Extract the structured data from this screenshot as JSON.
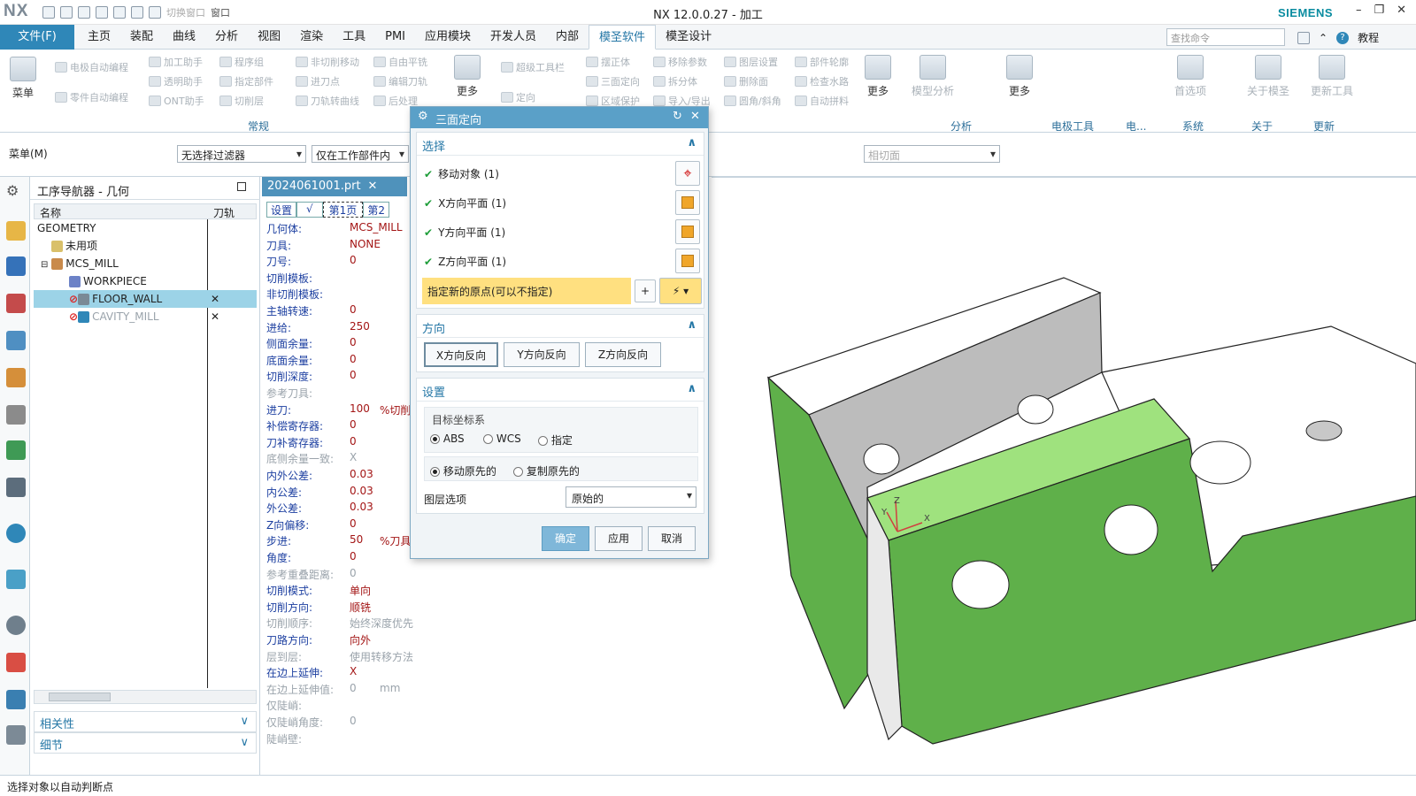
{
  "titlebar": {
    "logo": "NX",
    "quick_access": [
      "切换窗口",
      "窗口"
    ],
    "title": "NX 12.0.0.27 - 加工",
    "brand": "SIEMENS",
    "controls": [
      "–",
      "❐",
      "✕"
    ]
  },
  "menubar": {
    "file": "文件(F)",
    "tabs": [
      "主页",
      "装配",
      "曲线",
      "分析",
      "视图",
      "渲染",
      "工具",
      "PMI",
      "应用模块",
      "开发人员",
      "内部",
      "模圣软件",
      "模圣设计"
    ],
    "active_tab": "模圣软件",
    "search_placeholder": "查找命令",
    "tutorial": "教程"
  },
  "ribbon": {
    "menu_label": "菜单",
    "more_label": "更多",
    "col1": [
      "电极自动编程",
      "零件自动编程"
    ],
    "col2": [
      "加工助手",
      "透明助手",
      "ONT助手"
    ],
    "col3": [
      "程序组",
      "指定部件",
      "切削层"
    ],
    "col4": [
      "非切削移动",
      "进刀点",
      "刀轨转曲线"
    ],
    "col5": [
      "自由平铣",
      "编辑刀轨",
      "后处理"
    ],
    "col6": [
      "超级工具栏",
      "定向"
    ],
    "col7": [
      "摆正体",
      "三面定向",
      "区域保护"
    ],
    "col8": [
      "移除参数",
      "拆分体",
      "导入/导出"
    ],
    "col9": [
      "图层设置",
      "删除面",
      "圆角/斜角"
    ],
    "col10": [
      "部件轮廓",
      "检查水路",
      "自动拼料"
    ],
    "group_general": "常规",
    "model_analysis": "模型分析",
    "first_choice": "首选项",
    "about": "关于模圣",
    "update_tool": "更新工具",
    "groups_right": [
      "分析",
      "电极工具",
      "电...",
      "系统",
      "关于",
      "更新"
    ]
  },
  "toolbar2": {
    "menu_m": "菜单(M)",
    "filter": "无选择过滤器",
    "scope": "仅在工作部件内",
    "snap": "相切面"
  },
  "nav": {
    "title": "工序导航器 - 几何",
    "col_name": "名称",
    "col_path": "刀轨",
    "rows": [
      {
        "label": "GEOMETRY",
        "mark": ""
      },
      {
        "label": "未用项",
        "mark": ""
      },
      {
        "label": "MCS_MILL",
        "mark": ""
      },
      {
        "label": "WORKPIECE",
        "mark": ""
      },
      {
        "label": "FLOOR_WALL",
        "mark": "✕"
      },
      {
        "label": "CAVITY_MILL",
        "mark": "✕"
      }
    ],
    "acc_related": "相关性",
    "acc_detail": "细节"
  },
  "file_tab": "2024061001.prt",
  "props": {
    "tabs": [
      "设置",
      "√",
      "第1页",
      "第2"
    ],
    "rows": [
      {
        "k": "几何体:",
        "v": "MCS_MILL",
        "u": ""
      },
      {
        "k": "刀具:",
        "v": "NONE",
        "u": ""
      },
      {
        "k": "刀号:",
        "v": "0",
        "u": ""
      },
      {
        "k": "切削模板:",
        "v": "",
        "u": ""
      },
      {
        "k": "非切削模板:",
        "v": "",
        "u": ""
      },
      {
        "k": "主轴转速:",
        "v": "0",
        "u": ""
      },
      {
        "k": "进给:",
        "v": "250",
        "u": ""
      },
      {
        "k": "侧面余量:",
        "v": "0",
        "u": ""
      },
      {
        "k": "底面余量:",
        "v": "0",
        "u": ""
      },
      {
        "k": "切削深度:",
        "v": "0",
        "u": ""
      },
      {
        "k": "参考刀具:",
        "v": "",
        "u": "",
        "grey": true
      },
      {
        "k": "进刀:",
        "v": "100",
        "u": "%切削"
      },
      {
        "k": "补偿寄存器:",
        "v": "0",
        "u": ""
      },
      {
        "k": "刀补寄存器:",
        "v": "0",
        "u": ""
      },
      {
        "k": "底侧余量一致:",
        "v": "X",
        "u": "",
        "grey": true
      },
      {
        "k": "内外公差:",
        "v": "0.03",
        "u": ""
      },
      {
        "k": "内公差:",
        "v": "0.03",
        "u": ""
      },
      {
        "k": "外公差:",
        "v": "0.03",
        "u": ""
      },
      {
        "k": "Z向偏移:",
        "v": "0",
        "u": ""
      },
      {
        "k": "步进:",
        "v": "50",
        "u": "%刀具"
      },
      {
        "k": "角度:",
        "v": "0",
        "u": ""
      },
      {
        "k": "参考重叠距离:",
        "v": "0",
        "u": "",
        "grey": true
      },
      {
        "k": "切削模式:",
        "v": "单向",
        "u": ""
      },
      {
        "k": "切削方向:",
        "v": "顺铣",
        "u": ""
      },
      {
        "k": "切削顺序:",
        "v": "始终深度优先",
        "u": "",
        "grey": true
      },
      {
        "k": "刀路方向:",
        "v": "向外",
        "u": ""
      },
      {
        "k": "层到层:",
        "v": "使用转移方法",
        "u": "",
        "grey": true
      },
      {
        "k": "在边上延伸:",
        "v": "X",
        "u": ""
      },
      {
        "k": "在边上延伸值:",
        "v": "0",
        "u": "mm",
        "grey": true
      },
      {
        "k": "仅陡峭:",
        "v": "",
        "u": "",
        "grey": true
      },
      {
        "k": "仅陡峭角度:",
        "v": "0",
        "u": "",
        "grey": true
      },
      {
        "k": "陡峭壁:",
        "v": "",
        "u": "",
        "grey": true
      }
    ]
  },
  "dialog": {
    "title": "三面定向",
    "sec_select": "选择",
    "select_rows": [
      "移动对象 (1)",
      "X方向平面 (1)",
      "Y方向平面 (1)",
      "Z方向平面 (1)"
    ],
    "origin_prompt": "指定新的原点(可以不指定)",
    "sec_direction": "方向",
    "dir_buttons": [
      "X方向反向",
      "Y方向反向",
      "Z方向反向"
    ],
    "sec_settings": "设置",
    "target_cs": "目标坐标系",
    "cs_options": [
      "ABS",
      "WCS",
      "指定"
    ],
    "cs_selected": "ABS",
    "move_options": [
      "移动原先的",
      "复制原先的"
    ],
    "move_selected": "移动原先的",
    "layer_label": "图层选项",
    "layer_value": "原始的",
    "ok": "确定",
    "apply": "应用",
    "cancel": "取消"
  },
  "viewport": {
    "axis_labels": [
      "Z",
      "Y",
      "X"
    ],
    "part_color": "#5fb04a",
    "highlight_color": "#9fe27e"
  },
  "status": "选择对象以自动判断点"
}
